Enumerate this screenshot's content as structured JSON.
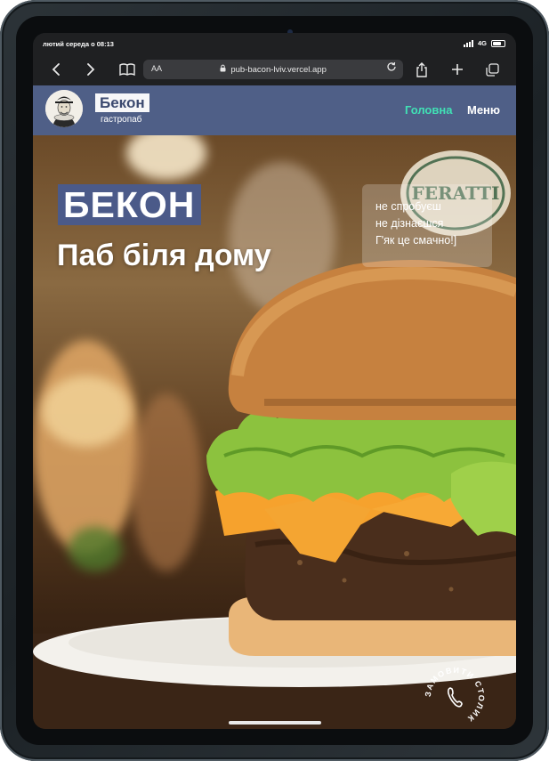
{
  "status_bar": {
    "datetime": "лютий середа о 08:13",
    "network": "4G",
    "icons": [
      "signal-icon",
      "battery-icon"
    ]
  },
  "browser": {
    "text_size_label": "AA",
    "url": "pub-bacon-lviv.vercel.app",
    "icons": [
      "back-icon",
      "forward-icon",
      "bookmarks-icon",
      "lock-icon",
      "reload-icon",
      "share-icon",
      "new-tab-icon",
      "tabs-icon"
    ]
  },
  "site_header": {
    "brand_name": "Бекон",
    "brand_subtitle": "гастропаб",
    "nav": {
      "home": "Головна",
      "menu": "Меню"
    },
    "colors": {
      "header_bg": "#4f5f87",
      "active_link": "#41e0b5"
    }
  },
  "hero": {
    "title": "БЕКОН",
    "subtitle": "Паб біля дому",
    "tagline": [
      "не спробуєш",
      "не дізнаєшся",
      "Г'як це смачно!]"
    ],
    "reserve_badge_text": "ЗАМОВИТИ СТОЛИК",
    "sign_text": "FERATTI",
    "colors": {
      "title_bg": "#4b5a89"
    }
  }
}
